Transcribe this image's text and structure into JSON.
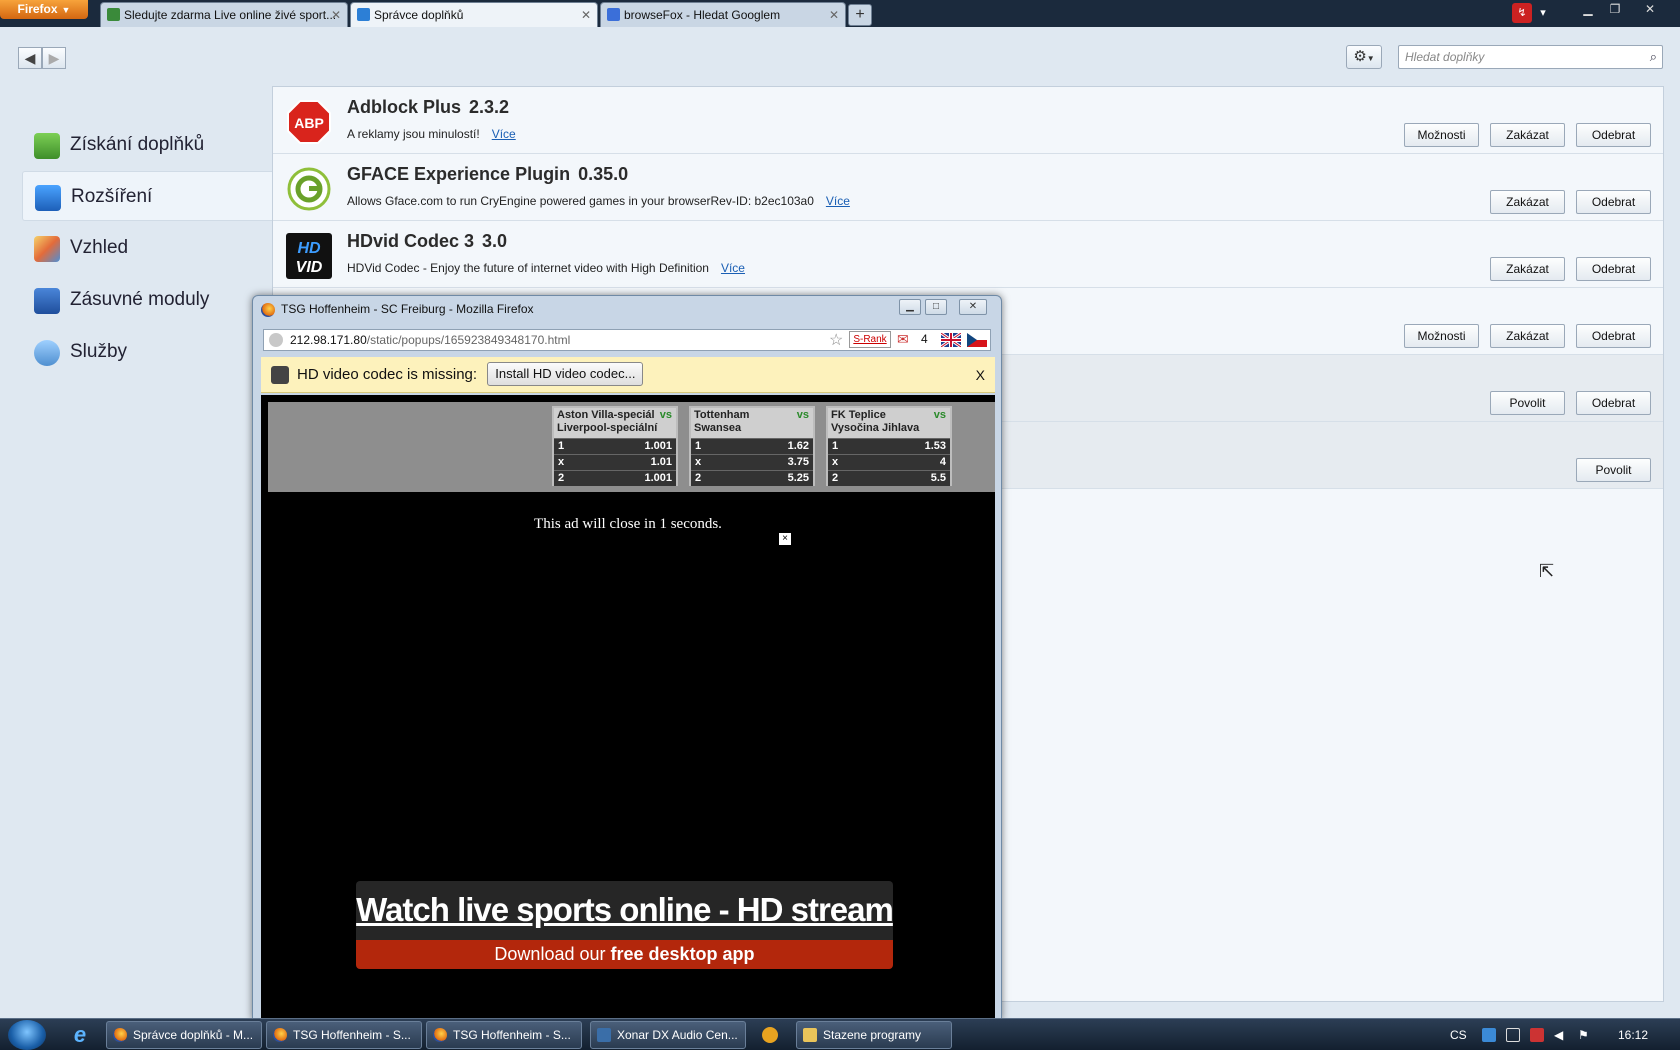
{
  "browser": {
    "menu_button": "Firefox",
    "tabs": [
      {
        "label": "Sledujte zdarma Live online živé sport..."
      },
      {
        "label": "Správce doplňků"
      },
      {
        "label": "browseFox - Hledat Googlem"
      }
    ],
    "new_tab": "+"
  },
  "addon_manager": {
    "search_placeholder": "Hledat doplňky",
    "categories": [
      {
        "label": "Získání doplňků"
      },
      {
        "label": "Rozšíření"
      },
      {
        "label": "Vzhled"
      },
      {
        "label": "Zásuvné moduly"
      },
      {
        "label": "Služby"
      }
    ],
    "addons": [
      {
        "name": "Adblock Plus",
        "version": "2.3.2",
        "description": "A reklamy jsou minulostí!",
        "more": "Více",
        "buttons": [
          "Možnosti",
          "Zakázat",
          "Odebrat"
        ]
      },
      {
        "name": "GFACE Experience Plugin",
        "version": "0.35.0",
        "description": "Allows Gface.com to run CryEngine powered games in your browserRev-ID: b2ec103a0",
        "more": "Více",
        "buttons": [
          "Zakázat",
          "Odebrat"
        ]
      },
      {
        "name": "HDvid Codec 3",
        "version": "3.0",
        "description": "HDVid Codec - Enjoy the future of internet video with High Definition",
        "more": "Více",
        "buttons": [
          "Zakázat",
          "Odebrat"
        ]
      },
      {
        "buttons": [
          "Možnosti",
          "Zakázat",
          "Odebrat"
        ]
      },
      {
        "buttons": [
          "Povolit",
          "Odebrat"
        ]
      },
      {
        "buttons": [
          "Povolit"
        ]
      }
    ]
  },
  "popup": {
    "title": "TSG Hoffenheim - SC Freiburg - Mozilla Firefox",
    "url_host": "212.98.171.80",
    "url_path": "/static/popups/165923849348170.html",
    "srank": "S-Rank",
    "mail_count": "4",
    "notification": "HD video codec is missing:",
    "install_button": "Install HD video codec...",
    "notification_close": "X",
    "matches": [
      {
        "home": "Aston Villa-speciál",
        "away": "Liverpool-speciální",
        "vs": "vs",
        "odds": [
          [
            "1",
            "1.001"
          ],
          [
            "x",
            "1.01"
          ],
          [
            "2",
            "1.001"
          ]
        ]
      },
      {
        "home": "Tottenham",
        "away": "Swansea",
        "vs": "vs",
        "odds": [
          [
            "1",
            "1.62"
          ],
          [
            "x",
            "3.75"
          ],
          [
            "2",
            "5.25"
          ]
        ]
      },
      {
        "home": "FK Teplice",
        "away": "Vysočina Jihlava",
        "vs": "vs",
        "odds": [
          [
            "1",
            "1.53"
          ],
          [
            "x",
            "4"
          ],
          [
            "2",
            "5.5"
          ]
        ]
      }
    ],
    "countdown": "This ad will close in 1 seconds.",
    "ad_close": "×",
    "banner_headline": "Watch live sports online - HD stream",
    "banner_sub_prefix": "Download our",
    "banner_sub_bold": "free desktop app"
  },
  "taskbar": {
    "items": [
      {
        "label": "Správce doplňků - M..."
      },
      {
        "label": "TSG Hoffenheim - S..."
      },
      {
        "label": "TSG Hoffenheim - S..."
      },
      {
        "label": "Xonar DX Audio Cen..."
      },
      {
        "label": "Stazene programy"
      }
    ],
    "language": "CS",
    "clock": "16:12"
  },
  "colors": {
    "notification_bg": "#fdf2bc",
    "banner_red": "#b3270c",
    "link_blue": "#1a5fb4"
  }
}
